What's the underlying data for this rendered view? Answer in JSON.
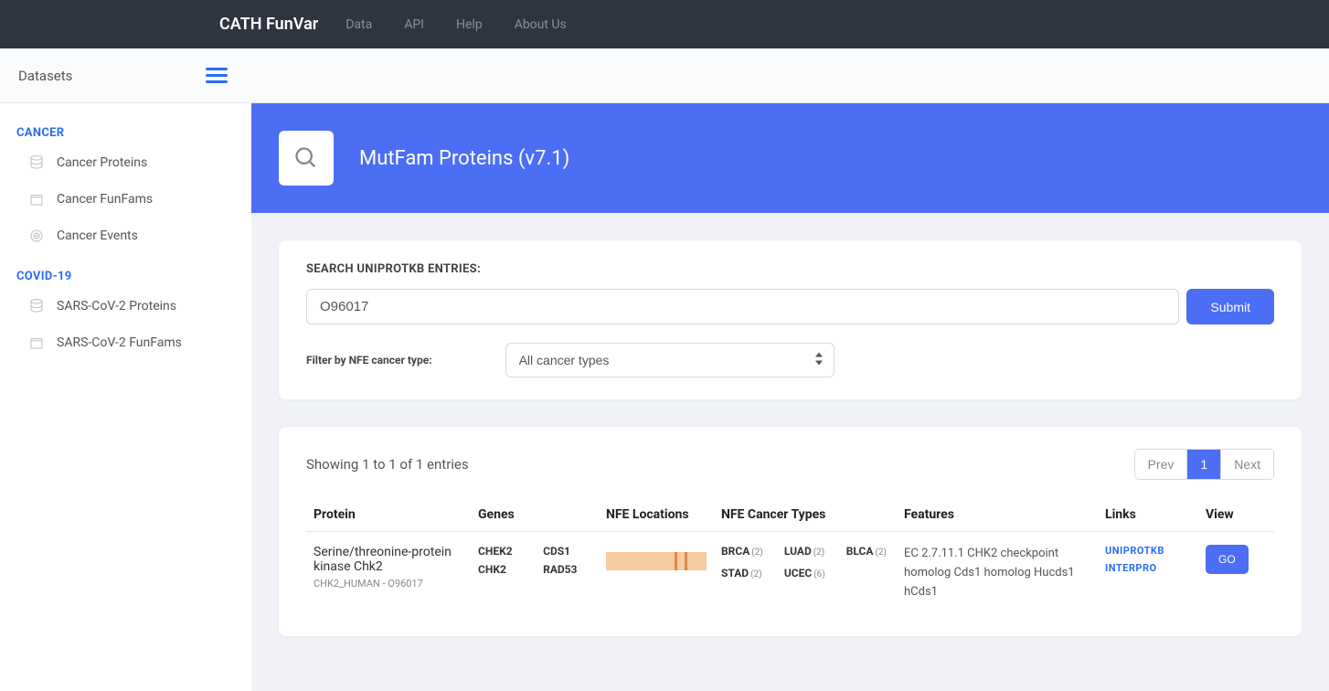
{
  "nav": {
    "brand": "CATH FunVar",
    "links": [
      "Data",
      "API",
      "Help",
      "About Us"
    ]
  },
  "subheader": {
    "title": "Datasets"
  },
  "sidebar": {
    "sections": [
      {
        "title": "CANCER",
        "items": [
          {
            "label": "Cancer Proteins",
            "icon": "db"
          },
          {
            "label": "Cancer FunFams",
            "icon": "box"
          },
          {
            "label": "Cancer Events",
            "icon": "target"
          }
        ]
      },
      {
        "title": "COVID-19",
        "items": [
          {
            "label": "SARS-CoV-2 Proteins",
            "icon": "db"
          },
          {
            "label": "SARS-CoV-2 FunFams",
            "icon": "box"
          }
        ]
      }
    ]
  },
  "hero": {
    "title": "MutFam Proteins (v7.1)"
  },
  "search": {
    "label": "SEARCH UNIPROTKB ENTRIES:",
    "value": "O96017",
    "submit": "Submit",
    "filterLabel": "Filter by NFE cancer type:",
    "filterValue": "All cancer types"
  },
  "results": {
    "showing": "Showing 1 to 1 of 1 entries",
    "pagination": {
      "prev": "Prev",
      "current": "1",
      "next": "Next"
    },
    "columns": [
      "Protein",
      "Genes",
      "NFE Locations",
      "NFE Cancer Types",
      "Features",
      "Links",
      "View"
    ],
    "rows": [
      {
        "proteinName": "Serine/threonine-protein kinase Chk2",
        "proteinSub": "CHK2_HUMAN - O96017",
        "genes": [
          "CHEK2",
          "CDS1",
          "CHK2",
          "RAD53"
        ],
        "cancerTypes": [
          {
            "name": "BRCA",
            "count": "(2)"
          },
          {
            "name": "LUAD",
            "count": "(2)"
          },
          {
            "name": "BLCA",
            "count": "(2)"
          },
          {
            "name": "STAD",
            "count": "(2)"
          },
          {
            "name": "UCEC",
            "count": "(6)"
          }
        ],
        "features": "EC 2.7.11.1 CHK2 checkpoint homolog Cds1 homolog Hucds1 hCds1",
        "links": [
          "UNIPROTKB",
          "INTERPRO"
        ],
        "viewLabel": "GO"
      }
    ]
  }
}
